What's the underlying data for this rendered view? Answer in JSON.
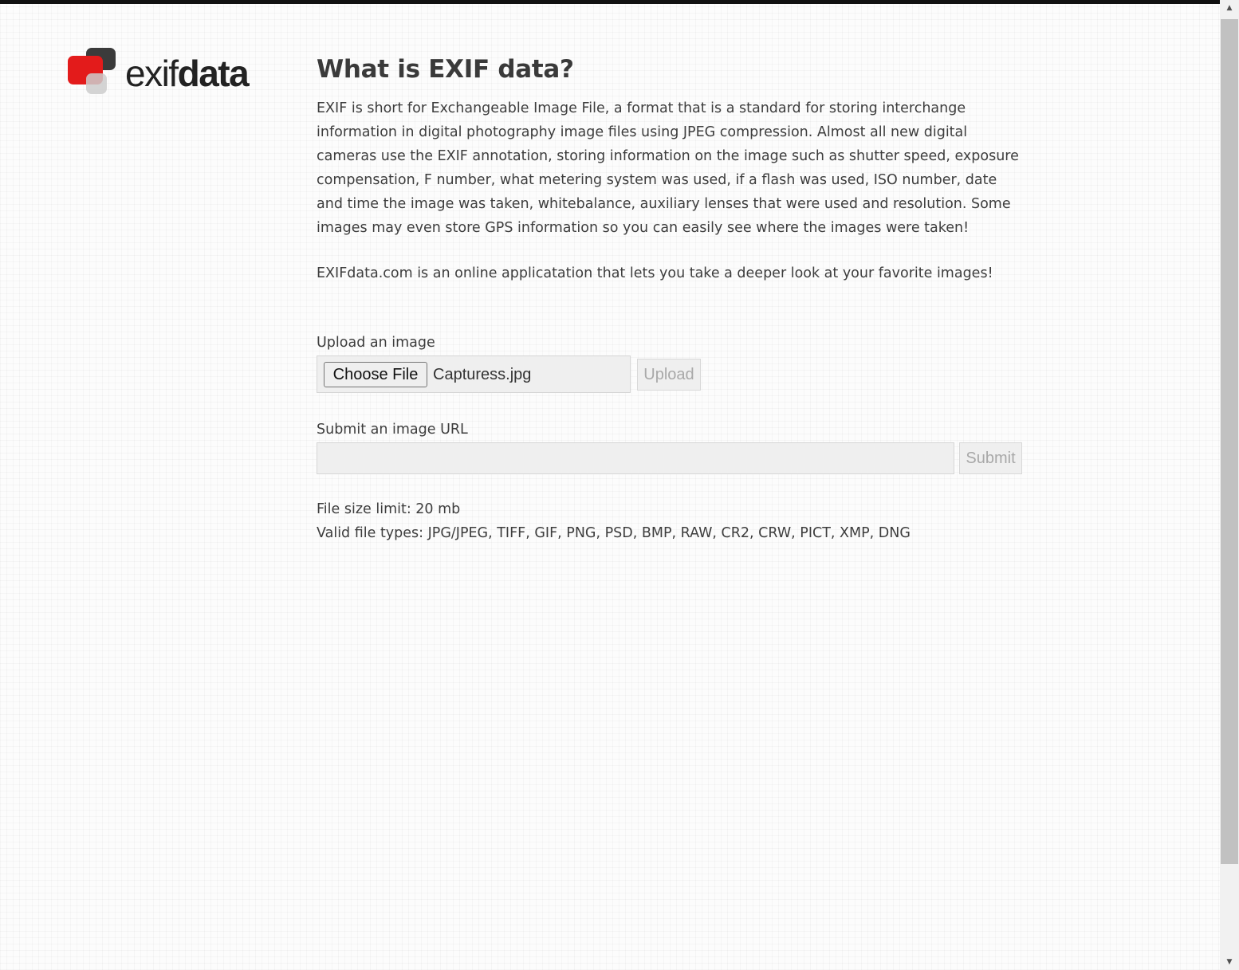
{
  "logo": {
    "text_light": "exif",
    "text_bold": "data"
  },
  "main": {
    "title": "What is EXIF data?",
    "description": "EXIF is short for Exchangeable Image File, a format that is a standard for storing interchange information in digital photography image files using JPEG compression. Almost all new digital cameras use the EXIF annotation, storing information on the image such as shutter speed, exposure compensation, F number, what metering system was used, if a flash was used, ISO number, date and time the image was taken, whitebalance, auxiliary lenses that were used and resolution. Some images may even store GPS information so you can easily see where the images were taken!",
    "tagline": "EXIFdata.com is an online applicatation that lets you take a deeper look at your favorite images!"
  },
  "upload": {
    "label": "Upload an image",
    "choose_label": "Choose File",
    "file_name": "Capturess.jpg",
    "button_label": "Upload"
  },
  "url_form": {
    "label": "Submit an image URL",
    "value": "",
    "button_label": "Submit"
  },
  "limits": {
    "size_limit": "File size limit: 20 mb",
    "valid_types": "Valid file types: JPG/JPEG, TIFF, GIF, PNG, PSD, BMP, RAW, CR2, CRW, PICT, XMP, DNG"
  },
  "scrollbar": {
    "up_icon": "triangle-up",
    "down_icon": "triangle-down"
  },
  "colors": {
    "accent_red": "#e31b1b",
    "logo_dark": "#3b3b3b",
    "text": "#3d3d3d"
  }
}
